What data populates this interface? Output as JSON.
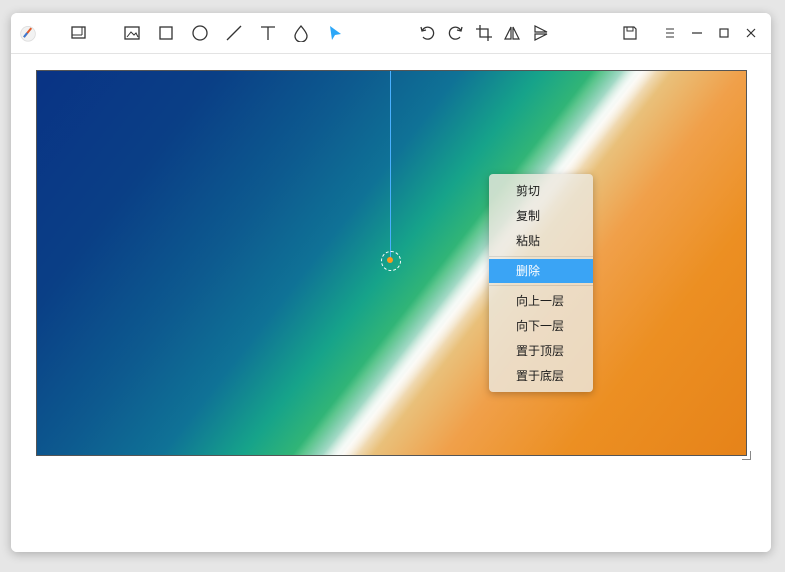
{
  "toolbar": {
    "tools": [
      {
        "name": "app-logo-icon"
      },
      {
        "name": "screenshot-icon"
      },
      {
        "name": "image-icon"
      },
      {
        "name": "rectangle-icon"
      },
      {
        "name": "ellipse-icon"
      },
      {
        "name": "line-icon"
      },
      {
        "name": "text-icon"
      },
      {
        "name": "blur-icon"
      },
      {
        "name": "select-pointer-icon",
        "active": true
      },
      {
        "name": "undo-icon"
      },
      {
        "name": "redo-icon"
      },
      {
        "name": "crop-icon"
      },
      {
        "name": "flip-icon"
      },
      {
        "name": "flip-vertical-icon"
      },
      {
        "name": "save-icon"
      },
      {
        "name": "menu-icon"
      },
      {
        "name": "minimize-icon"
      },
      {
        "name": "maximize-icon"
      },
      {
        "name": "close-icon"
      }
    ],
    "accent_color": "#2ca7f8"
  },
  "context_menu": {
    "items": [
      {
        "label": "剪切"
      },
      {
        "label": "复制"
      },
      {
        "label": "粘贴"
      },
      {
        "label": "删除",
        "highlighted": true
      },
      {
        "label": "向上一层"
      },
      {
        "label": "向下一层"
      },
      {
        "label": "置于顶层"
      },
      {
        "label": "置于底层"
      }
    ],
    "highlight_color": "#3aa4f5"
  }
}
